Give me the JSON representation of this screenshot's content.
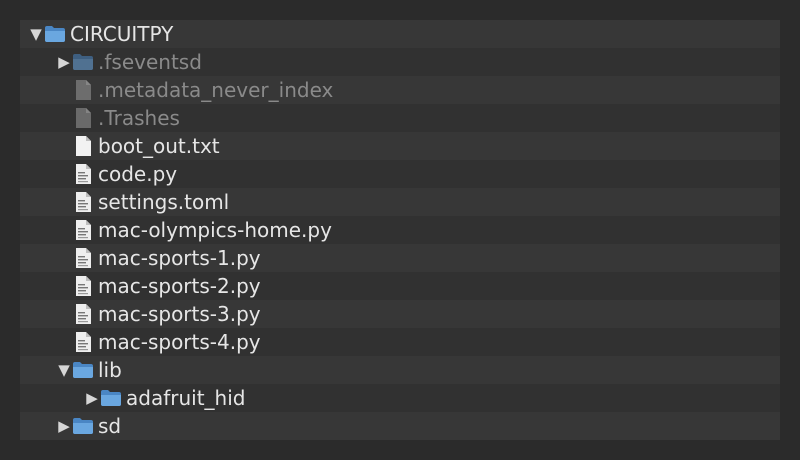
{
  "tree": {
    "root": {
      "label": "CIRCUITPY",
      "icon": "folder-icon",
      "expanded": true
    },
    "items": [
      {
        "label": ".fseventsd",
        "icon": "folder-icon",
        "type": "folder",
        "collapsed": true,
        "hidden_file": true
      },
      {
        "label": ".metadata_never_index",
        "icon": "file-icon",
        "type": "file",
        "hidden_file": true
      },
      {
        "label": ".Trashes",
        "icon": "file-icon",
        "type": "file",
        "hidden_file": true
      },
      {
        "label": "boot_out.txt",
        "icon": "text-file-icon",
        "type": "file"
      },
      {
        "label": "code.py",
        "icon": "script-file-icon",
        "type": "file"
      },
      {
        "label": "settings.toml",
        "icon": "script-file-icon",
        "type": "file"
      },
      {
        "label": "mac-olympics-home.py",
        "icon": "script-file-icon",
        "type": "file"
      },
      {
        "label": "mac-sports-1.py",
        "icon": "script-file-icon",
        "type": "file"
      },
      {
        "label": "mac-sports-2.py",
        "icon": "script-file-icon",
        "type": "file"
      },
      {
        "label": "mac-sports-3.py",
        "icon": "script-file-icon",
        "type": "file"
      },
      {
        "label": "mac-sports-4.py",
        "icon": "script-file-icon",
        "type": "file"
      },
      {
        "label": "lib",
        "icon": "folder-icon",
        "type": "folder",
        "expanded": true
      },
      {
        "label": "adafruit_hid",
        "icon": "folder-icon",
        "type": "folder",
        "collapsed": true
      },
      {
        "label": "sd",
        "icon": "folder-icon",
        "type": "folder",
        "collapsed": true
      }
    ]
  },
  "colors": {
    "background": "#2b2b2b",
    "panel": "#313131",
    "row_alt": "#373737",
    "folder_blue": "#5b9bd8",
    "text": "#e6e6e6",
    "text_dim": "#8a8a8a"
  }
}
